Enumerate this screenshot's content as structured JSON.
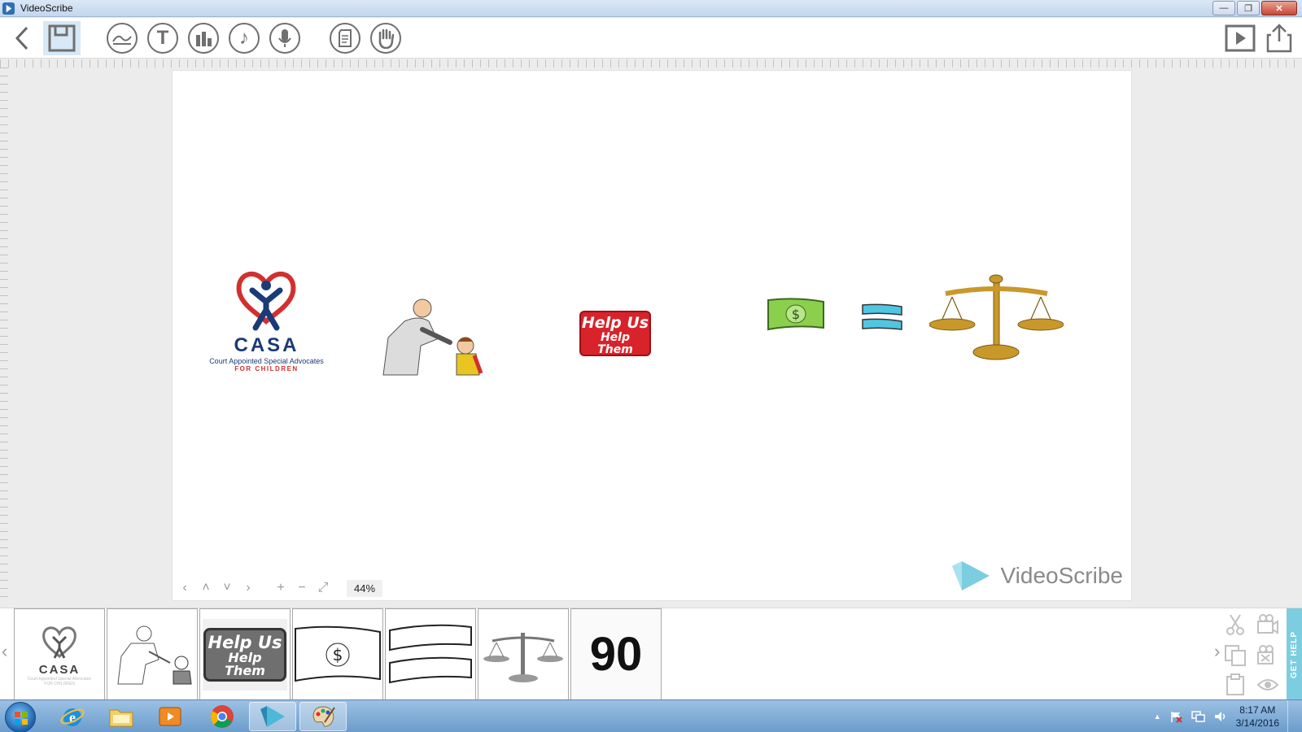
{
  "window": {
    "title": "VideoScribe",
    "minimize": "—",
    "restore": "❐",
    "close": "✕"
  },
  "toolbar": {
    "items": [
      {
        "name": "back-icon"
      },
      {
        "name": "save-icon"
      },
      {
        "name": "background-icon"
      },
      {
        "name": "text-icon",
        "glyph": "T"
      },
      {
        "name": "chart-icon"
      },
      {
        "name": "music-icon",
        "glyph": "♪"
      },
      {
        "name": "voiceover-icon"
      },
      {
        "name": "properties-icon"
      },
      {
        "name": "hand-icon"
      }
    ],
    "right": [
      {
        "name": "preview-play-icon"
      },
      {
        "name": "share-export-icon"
      }
    ]
  },
  "canvas": {
    "casa": {
      "title": "CASA",
      "subtitle": "Court Appointed Special Advocates",
      "tag": "FOR CHILDREN"
    },
    "helpus": {
      "line1": "Help Us",
      "line2": "Help Them"
    },
    "watermark": "VideoScribe",
    "nav": {
      "left": "‹",
      "up": "˄",
      "down": "˅",
      "right": "›",
      "zoom_in": "+",
      "zoom_out": "−",
      "fit": "⤢",
      "zoom_level": "44%"
    }
  },
  "timeline": {
    "left_arrow": "‹",
    "right_arrow": "›",
    "thumbs": [
      {
        "type": "casa",
        "title": "CASA",
        "subtitle": "Court Appointed Special Advocates",
        "tag": "FOR CHILDREN"
      },
      {
        "type": "man-child"
      },
      {
        "type": "helpus",
        "line1": "Help Us",
        "line2": "Help Them"
      },
      {
        "type": "dollar"
      },
      {
        "type": "equals"
      },
      {
        "type": "scales"
      },
      {
        "type": "number",
        "text": "90"
      }
    ],
    "get_help": "GET HELP"
  },
  "taskbar": {
    "time": "8:17 AM",
    "date": "3/14/2016"
  },
  "colors": {
    "casa_blue": "#1a3a78",
    "casa_red": "#d23030",
    "helpus_red": "#d8232a",
    "money_green": "#8ccf4c",
    "equals_cyan": "#4fc6e2",
    "scales_gold": "#c9982a",
    "brand_teal": "#7dcde0"
  }
}
